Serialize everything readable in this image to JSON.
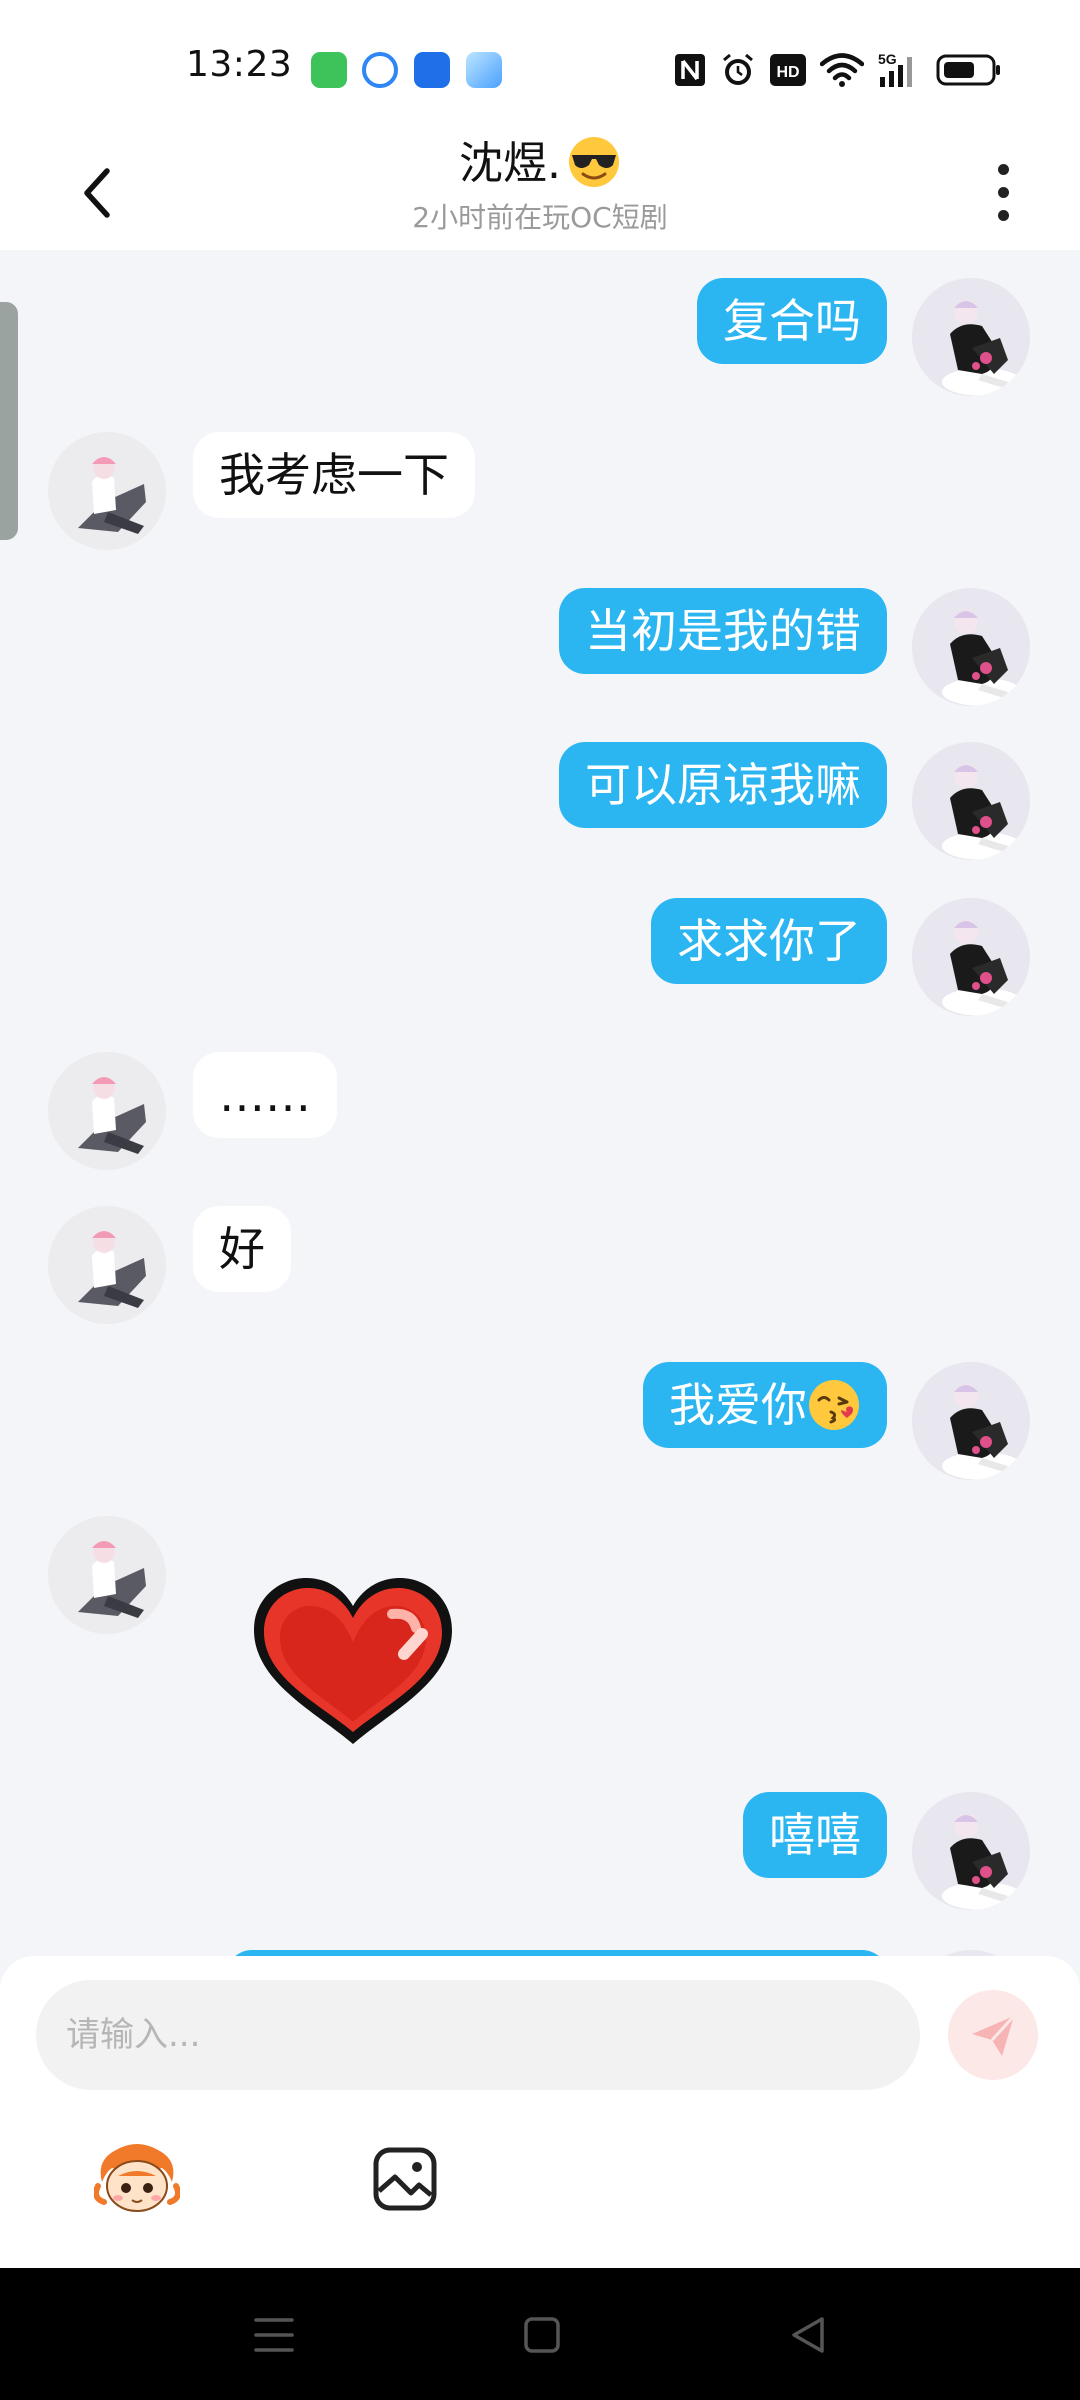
{
  "status_bar": {
    "time": "13:23",
    "notification_icons": [
      "messages-icon",
      "tencent-map-icon",
      "messenger-app-icon",
      "travel-app-icon"
    ],
    "right_icons": [
      "nfc-icon",
      "alarm-icon",
      "hd-icon",
      "wifi-icon",
      "5g-signal-icon",
      "battery-icon"
    ],
    "network_label": "5G",
    "hd_label": "HD"
  },
  "header": {
    "title": "沈煜.",
    "title_emoji": "smiling-face-with-sunglasses-icon",
    "subtitle": "2小时前在玩OC短剧"
  },
  "messages": [
    {
      "sender": "me",
      "text": "复合吗"
    },
    {
      "sender": "other",
      "text": "我考虑一下"
    },
    {
      "sender": "me",
      "text": "当初是我的错"
    },
    {
      "sender": "me",
      "text": "可以原谅我嘛"
    },
    {
      "sender": "me",
      "text": "求求你了"
    },
    {
      "sender": "other",
      "text": "……"
    },
    {
      "sender": "other",
      "text": "好"
    },
    {
      "sender": "me",
      "text": "我爱你",
      "emoji": "kissing-face-icon"
    },
    {
      "sender": "other",
      "sticker": "red-heart-sticker"
    },
    {
      "sender": "me",
      "text": "嘻嘻"
    }
  ],
  "input": {
    "placeholder": "请输入..."
  },
  "colors": {
    "my_bubble": "#2bb6f2",
    "other_bubble": "#ffffff",
    "background": "#f3f5f8",
    "send_button": "#f7a3a3"
  }
}
